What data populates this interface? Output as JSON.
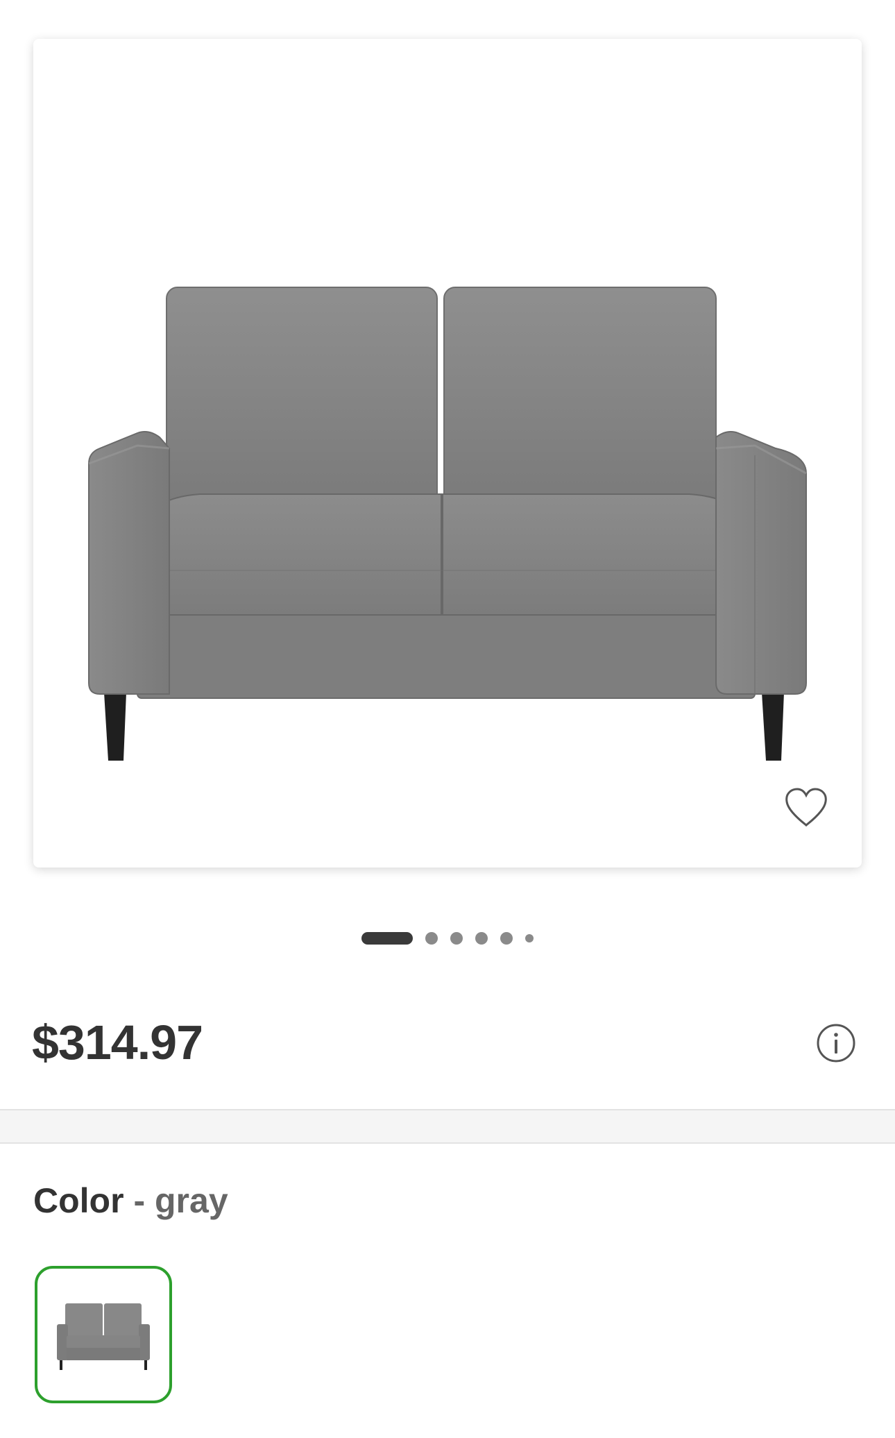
{
  "product": {
    "image_icon": "gray-loveseat-image",
    "favorite_icon": "heart-outline-icon",
    "carousel": {
      "total_images": 6,
      "active_index": 0
    },
    "price": "$314.97",
    "info_icon": "info-circle-icon"
  },
  "color_selector": {
    "label": "Color",
    "separator": "-",
    "selected_value": "gray",
    "swatches": [
      {
        "name": "gray",
        "selected": true,
        "border_color": "#2da02d"
      }
    ]
  },
  "colors": {
    "accent": "#2da02d",
    "text_primary": "#333333",
    "text_secondary": "#666666"
  }
}
